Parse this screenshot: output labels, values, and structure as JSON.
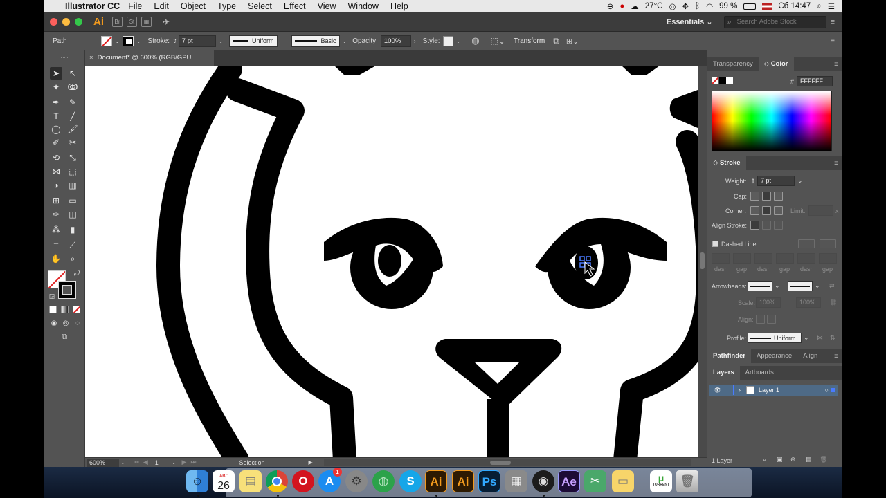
{
  "menubar": {
    "app_name": "Illustrator CC",
    "items": [
      "File",
      "Edit",
      "Object",
      "Type",
      "Select",
      "Effect",
      "View",
      "Window",
      "Help"
    ],
    "temperature": "27°C",
    "battery": "99 %",
    "clock": "Сб 14:47"
  },
  "appbar": {
    "logo": "Ai",
    "br": "Br",
    "st": "St",
    "workspace": "Essentials",
    "search_placeholder": "Search Adobe Stock"
  },
  "controlbar": {
    "selection_type": "Path",
    "stroke_label": "Stroke:",
    "stroke_value": "7 pt",
    "profile": "Uniform",
    "brush": "Basic",
    "opacity_label": "Opacity:",
    "opacity_value": "100%",
    "style_label": "Style:",
    "transform_label": "Transform"
  },
  "document": {
    "tab_title": "Document* @ 600% (RGB/GPU Preview)",
    "zoom": "600%",
    "artboard": "1",
    "status_tool": "Selection"
  },
  "color_panel": {
    "tab_transparency": "Transparency",
    "tab_color": "Color",
    "hash": "#",
    "hex": "FFFFFF"
  },
  "stroke_panel": {
    "title": "Stroke",
    "weight_label": "Weight:",
    "weight_value": "7 pt",
    "cap_label": "Cap:",
    "corner_label": "Corner:",
    "limit_label": "Limit:",
    "limit_x": "x",
    "align_label": "Align Stroke:",
    "dashed_label": "Dashed Line",
    "dash_labels": [
      "dash",
      "gap",
      "dash",
      "gap",
      "dash",
      "gap"
    ],
    "arrowheads_label": "Arrowheads:",
    "scale_label": "Scale:",
    "scale_value_1": "100%",
    "scale_value_2": "100%",
    "align_arrow_label": "Align:",
    "profile_label": "Profile:",
    "profile_value": "Uniform"
  },
  "pathfinder_tabs": [
    "Pathfinder",
    "Appearance",
    "Align"
  ],
  "layers_panel": {
    "tab_layers": "Layers",
    "tab_artboards": "Artboards",
    "layer_name": "Layer 1",
    "count": "1 Layer"
  },
  "dock": {
    "calendar_day": "26",
    "calendar_month": "АВГ",
    "badge": "1",
    "ai1": "Ai",
    "ai2": "Ai",
    "ps": "Ps",
    "ae": "Ae",
    "torrent": "TORRENT"
  }
}
